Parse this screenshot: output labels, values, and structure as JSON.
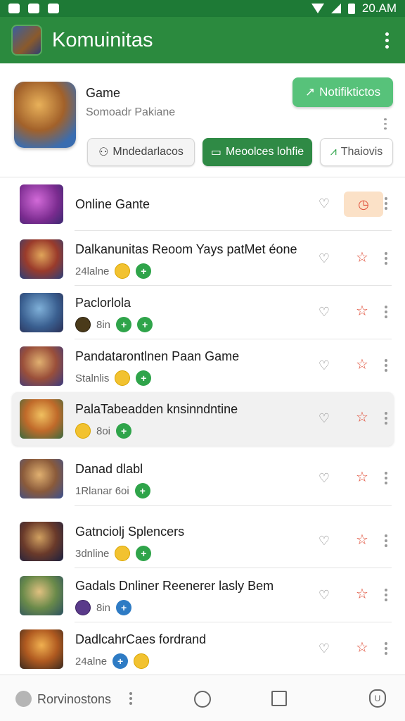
{
  "status_bar": {
    "time": "20.AM"
  },
  "app_bar": {
    "title": "Komuinitas"
  },
  "header": {
    "game_label": "Game",
    "game_sub": "Somoadr Pakiane",
    "notif_label": "Notifiktictos",
    "chips": [
      "Mndedarlacos",
      "Meoolces lohfie",
      "Thaiovis"
    ]
  },
  "colors": {
    "primary": "#2b8a3e",
    "accent": "#57c27a",
    "star": "#e0503a",
    "timer_bg": "#fbe1c7"
  },
  "list": [
    {
      "title": "Online Gante",
      "meta": ""
    },
    {
      "title": "Dalkanunitas Reoom Yays patMet éone",
      "meta": "24lalne"
    },
    {
      "title": "Paclorlola",
      "meta": "8in"
    },
    {
      "title": "Pandatarontlnen Paan Game",
      "meta": "Stalnlis"
    },
    {
      "title": "PalaTabeadden knsinndntine",
      "meta": "8oi"
    },
    {
      "title": "Danad dlabl",
      "meta": "1Rlanar 6oi"
    },
    {
      "title": "Gatnciolj Splencers",
      "meta": "3dnline"
    },
    {
      "title": "Gadals Dnliner Reenerer lasly Bem",
      "meta": "8in"
    },
    {
      "title": "DadlcahrCaes fordrand",
      "meta": "24alne"
    }
  ],
  "bottom_nav": {
    "label": "Rorvinostons"
  }
}
